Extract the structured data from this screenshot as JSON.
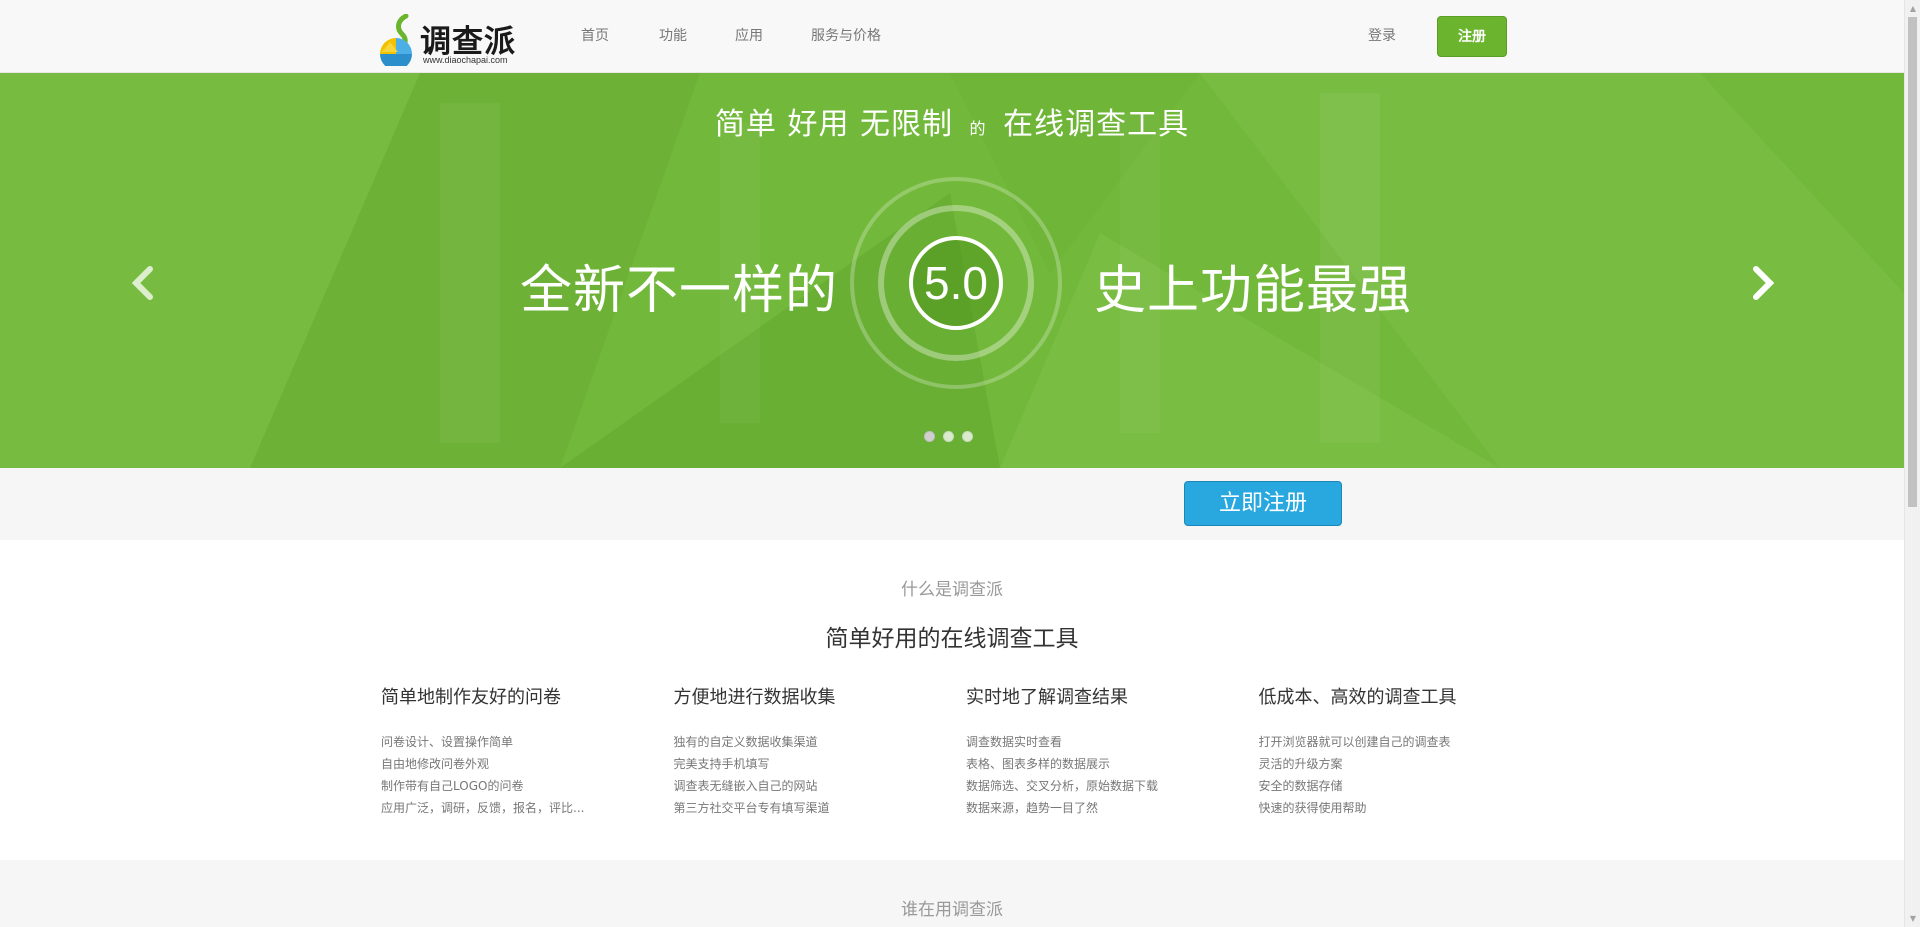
{
  "colors": {
    "hero_green": "#72b83a",
    "register_green": "#6ab42e",
    "cta_blue": "#29a8e0",
    "muted_text": "#777777"
  },
  "brand": {
    "logo_text": "调查派",
    "logo_url": "www.diaochapai.com",
    "logo_icon": "survey-logo-icon"
  },
  "nav": {
    "items": [
      {
        "label": "首页"
      },
      {
        "label": "功能"
      },
      {
        "label": "应用"
      },
      {
        "label": "服务与价格"
      }
    ],
    "login_label": "登录",
    "register_label": "注册"
  },
  "hero": {
    "tagline_part1": "简单 好用 无限制",
    "tagline_small": "的",
    "tagline_part2": "在线调查工具",
    "left_text": "全新不一样的",
    "version": "5.0",
    "right_text": "史上功能最强",
    "prev_icon": "chevron-left-icon",
    "next_icon": "chevron-right-icon",
    "slide_count": 3,
    "active_slide": 1
  },
  "cta": {
    "button_label": "立即注册"
  },
  "about": {
    "eyebrow": "什么是调查派",
    "title": "简单好用的在线调查工具",
    "features": [
      {
        "title": "简单地制作友好的问卷",
        "items": [
          "问卷设计、设置操作简单",
          "自由地修改问卷外观",
          "制作带有自己LOGO的问卷",
          "应用广泛，调研，反馈，报名，评比..."
        ]
      },
      {
        "title": "方便地进行数据收集",
        "items": [
          "独有的自定义数据收集渠道",
          "完美支持手机填写",
          "调查表无缝嵌入自己的网站",
          "第三方社交平台专有填写渠道"
        ]
      },
      {
        "title": "实时地了解调查结果",
        "items": [
          "调查数据实时查看",
          "表格、图表多样的数据展示",
          "数据筛选、交叉分析，原始数据下载",
          "数据来源，趋势一目了然"
        ]
      },
      {
        "title": "低成本、高效的调查工具",
        "items": [
          "打开浏览器就可以创建自己的调查表",
          "灵活的升级方案",
          "安全的数据存储",
          "快速的获得使用帮助"
        ]
      }
    ]
  },
  "users": {
    "eyebrow": "谁在用调查派"
  }
}
